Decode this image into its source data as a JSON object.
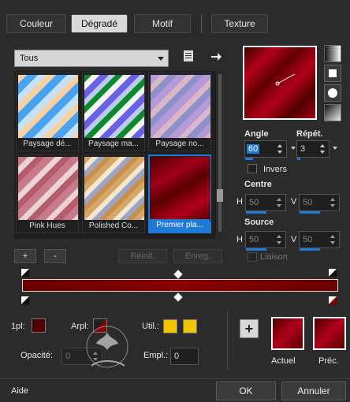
{
  "tabs": [
    {
      "label": "Couleur",
      "active": false
    },
    {
      "label": "Dégradé",
      "active": true
    },
    {
      "label": "Motif",
      "active": false
    },
    {
      "label": "Texture",
      "active": false
    }
  ],
  "category_select": {
    "value": "Tous"
  },
  "thumbnails": [
    {
      "caption": "Paysage dé..."
    },
    {
      "caption": "Paysage ma..."
    },
    {
      "caption": "Paysage no..."
    },
    {
      "caption": "Pink Hues"
    },
    {
      "caption": "Polished Co..."
    },
    {
      "caption": "Premier pla...",
      "selected": true
    }
  ],
  "list_buttons": {
    "add": "+",
    "remove": "-",
    "reset": "Réinit.",
    "save": "Enreg."
  },
  "angle": {
    "label": "Angle",
    "value": "60"
  },
  "repeat": {
    "label": "Répét.",
    "value": "3"
  },
  "invert": {
    "label": "Invers"
  },
  "center": {
    "label": "Centre",
    "h_label": "H",
    "h_value": "50",
    "v_label": "V",
    "v_value": "50"
  },
  "source": {
    "label": "Source",
    "h_label": "H",
    "h_value": "50",
    "v_label": "V",
    "v_value": "50"
  },
  "link": {
    "label": "Liaison"
  },
  "gradient_bar": {
    "colors": [
      "#5a0000",
      "#8b0000"
    ]
  },
  "bottom": {
    "fg_label": "1pl:",
    "bg_label": "Arpl:",
    "util_label": "Util.:",
    "opacity_label": "Opacité:",
    "opacity_value": "0",
    "location_label": "Empl.:",
    "location_value": "0",
    "current_label": "Actuel",
    "previous_label": "Préc.",
    "add_icon": "+"
  },
  "footer": {
    "help": "Aide",
    "ok": "OK",
    "cancel": "Annuler"
  },
  "colors": {
    "accent": "#1f7bd6",
    "utility_yellow": "#f5c400",
    "gradient_dark": "#5a0000",
    "gradient_light": "#b0001a"
  }
}
